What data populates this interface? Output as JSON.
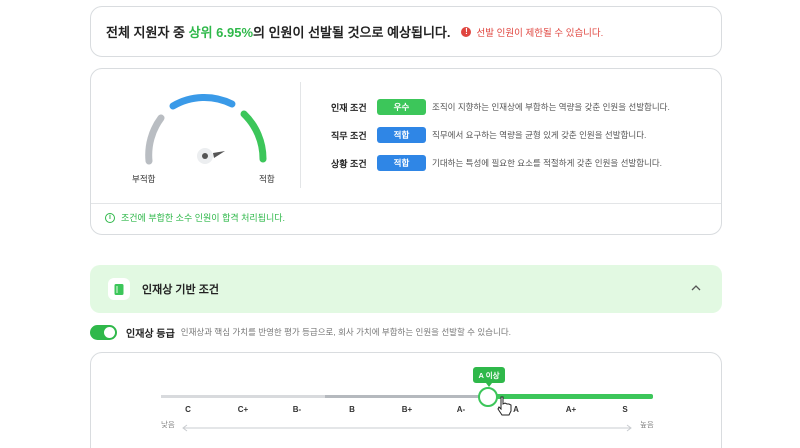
{
  "notice": {
    "text_prefix": "전체 지원자 중 ",
    "highlight": "상위 6.95%",
    "text_suffix": "의 인원이 선발될 것으로 예상됩니다.",
    "warning_icon": "!",
    "warning": "선발 인원이 제한될 수 있습니다."
  },
  "gauge": {
    "left_label": "부적합",
    "right_label": "적합",
    "level": 0.55
  },
  "conditions": [
    {
      "name": "인재 조건",
      "badge": "우수",
      "badge_color": "#3cc65a",
      "desc": "조직이 지향하는 인재상에 부합하는 역량을 갖춘 인원을 선발합니다."
    },
    {
      "name": "직무 조건",
      "badge": "적합",
      "badge_color": "#2f86e6",
      "desc": "직무에서 요구하는 역량을 균형 있게 갖춘 인원을 선발합니다."
    },
    {
      "name": "상황 조건",
      "badge": "적합",
      "badge_color": "#2f86e6",
      "desc": "기대하는 특성에 필요한 요소를 적절하게 갖춘 인원을 선발합니다."
    }
  ],
  "footnote": {
    "icon": "i",
    "text": "조건에 부합한 소수 인원이 합격 처리됩니다."
  },
  "section": {
    "title": "인재상 기반 조건",
    "icon": "book-icon"
  },
  "toggle": {
    "on": true,
    "title": "인재상 등급",
    "desc": "인재상과 핵심 가치를 반영한 평가 등급으로, 회사 가치에 부합하는 인원을 선발할 수 있습니다."
  },
  "grade_slider": {
    "grades": [
      "C",
      "C+",
      "B-",
      "B",
      "B+",
      "A-",
      "A",
      "A+",
      "S"
    ],
    "threshold_label": "A 이상",
    "threshold_index": 6,
    "low_label": "낮음",
    "high_label": "높음"
  },
  "colors": {
    "green": "#3cc65a",
    "blue": "#3a9ae8",
    "gray": "#b9bdc2",
    "red": "#e0453f"
  }
}
